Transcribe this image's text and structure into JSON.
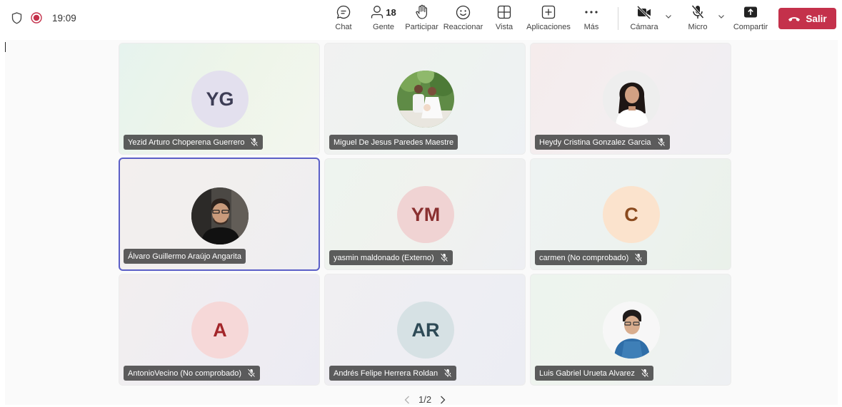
{
  "status": {
    "time": "19:09",
    "icons": [
      "shield-icon",
      "recording-icon"
    ]
  },
  "toolbar": {
    "chat_label": "Chat",
    "people_label": "Gente",
    "people_count": "18",
    "raise_label": "Participar",
    "react_label": "Reaccionar",
    "view_label": "Vista",
    "apps_label": "Aplicaciones",
    "more_label": "Más",
    "camera_label": "Cámara",
    "mic_label": "Micro",
    "share_label": "Compartir",
    "leave_label": "Salir"
  },
  "colors": {
    "accent": "#5b5fc7",
    "leave": "#c4314b"
  },
  "participants": [
    {
      "name": "Yezid Arturo Choperena Guerrero",
      "initials": "YG",
      "muted": true,
      "avatar": "initials"
    },
    {
      "name": "Miguel De Jesus Paredes Maestre",
      "initials": "",
      "muted": false,
      "avatar": "photo"
    },
    {
      "name": "Heydy Cristina Gonzalez Garcia",
      "initials": "",
      "muted": true,
      "avatar": "photo"
    },
    {
      "name": "Álvaro Guillermo Araújo Angarita",
      "initials": "",
      "muted": false,
      "avatar": "photo",
      "active": true
    },
    {
      "name": "yasmin maldonado (Externo)",
      "initials": "YM",
      "muted": true,
      "avatar": "initials"
    },
    {
      "name": "carmen (No comprobado)",
      "initials": "C",
      "muted": true,
      "avatar": "initials"
    },
    {
      "name": "AntonioVecino (No comprobado)",
      "initials": "A",
      "muted": true,
      "avatar": "initials"
    },
    {
      "name": "Andrés Felipe Herrera Roldan",
      "initials": "AR",
      "muted": true,
      "avatar": "initials"
    },
    {
      "name": "Luis Gabriel Urueta Alvarez",
      "initials": "",
      "muted": true,
      "avatar": "photo"
    }
  ],
  "pager": {
    "text": "1/2"
  }
}
